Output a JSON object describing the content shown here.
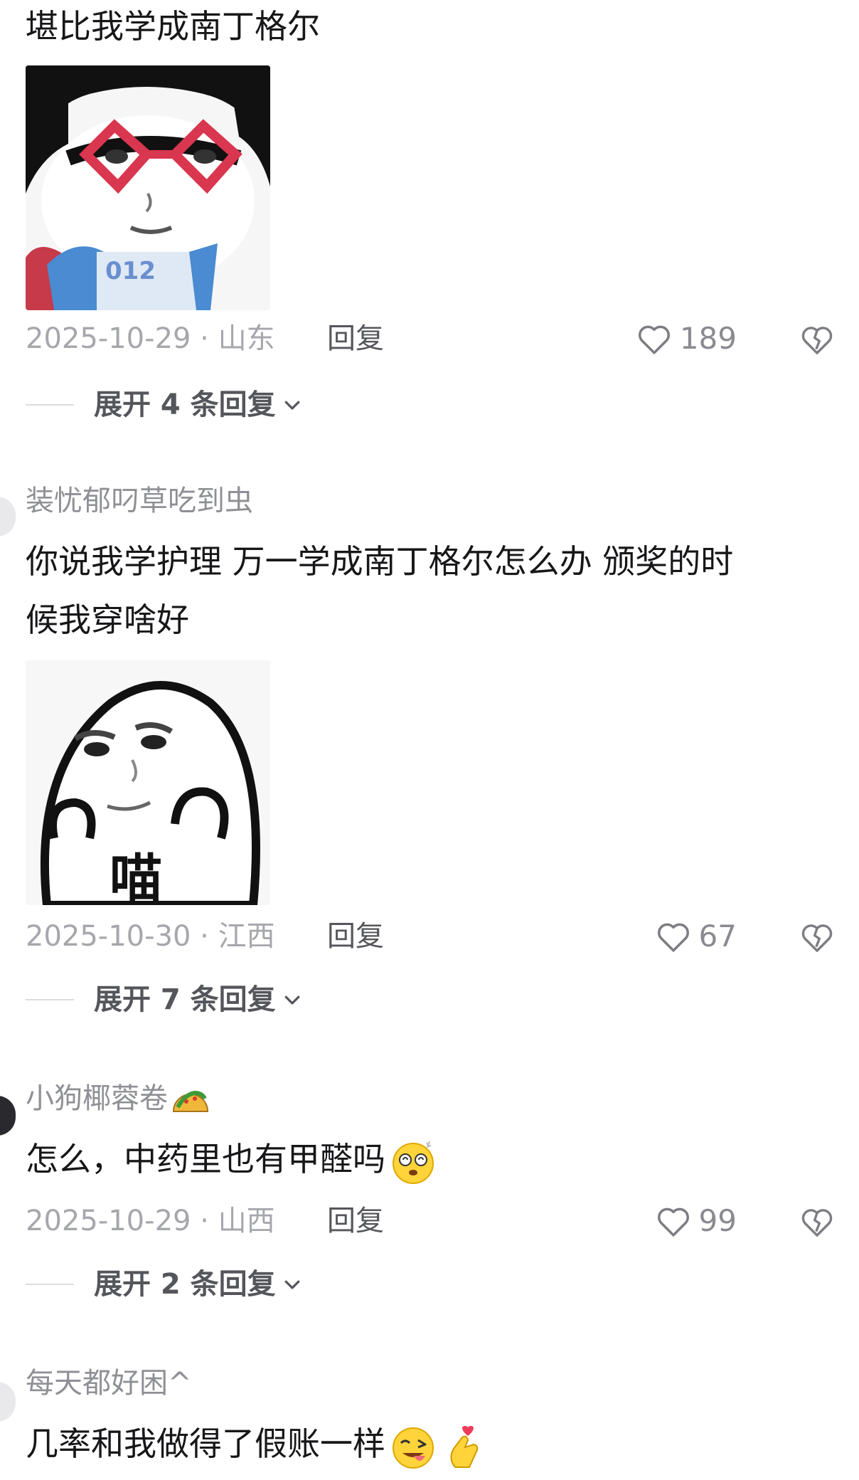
{
  "comments": [
    {
      "username": "",
      "text_lines": [
        "堪比我学成南丁格尔"
      ],
      "sticker": "bowl-cut-girl-red-glasses-sticker",
      "date": "2025-10-29",
      "location": "山东",
      "reply_label": "回复",
      "likes": "189",
      "expand_label": "展开 4 条回复"
    },
    {
      "username": "装忧郁叼草吃到虫",
      "text_lines": [
        "你说我学护理 万一学成南丁格尔怎么办 颁奖的时",
        "候我穿啥好"
      ],
      "sticker": "round-face-meow-sticker",
      "sticker_text": "喵",
      "date": "2025-10-30",
      "location": "江西",
      "reply_label": "回复",
      "likes": "67",
      "expand_label": "展开 7 条回复"
    },
    {
      "username": "小狗椰蓉卷",
      "username_emoji": "taco-icon",
      "text_lines": [
        "怎么，中药里也有甲醛吗"
      ],
      "text_emoji": "dizzy-face-icon",
      "date": "2025-10-29",
      "location": "山西",
      "reply_label": "回复",
      "likes": "99",
      "expand_label": "展开 2 条回复"
    },
    {
      "username": "每天都好困^",
      "text_lines": [
        "几率和我做得了假账一样"
      ],
      "text_emojis": [
        "winking-tongue-face-icon",
        "finger-heart-icon"
      ]
    }
  ],
  "colors": {
    "text_primary": "#17171a",
    "text_secondary": "#8f9095",
    "text_meta": "#a6a7ac",
    "sticker_glasses": "#d9364f"
  }
}
